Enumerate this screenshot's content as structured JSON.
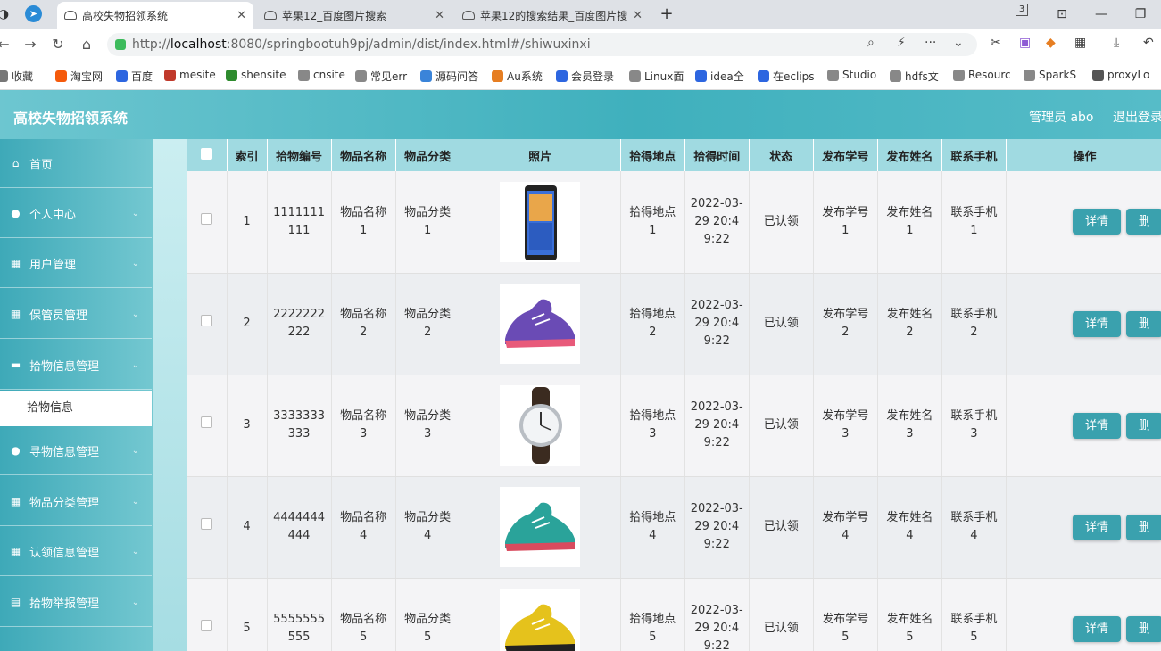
{
  "browser": {
    "tabs": [
      {
        "title": "高校失物招领系统"
      },
      {
        "title": "苹果12_百度图片搜索"
      },
      {
        "title": "苹果12的搜索结果_百度图片搜"
      }
    ],
    "new_tab_label": "+",
    "url_prefix": "http://",
    "url_host": "localhost",
    "url_rest": ":8080/springbootuh9pj/admin/dist/index.html#/shiwuxinxi",
    "bookmarks": [
      {
        "label": "收藏",
        "color": "#777777"
      },
      {
        "label": "淘宝网",
        "color": "#f55a0b"
      },
      {
        "label": "百度",
        "color": "#2d66e0"
      },
      {
        "label": "mesite",
        "color": "#c0392b"
      },
      {
        "label": "shensite",
        "color": "#2e8b2e"
      },
      {
        "label": "cnsite",
        "color": "#888888"
      },
      {
        "label": "常见err",
        "color": "#888888"
      },
      {
        "label": "源码问答",
        "color": "#3a84d9"
      },
      {
        "label": "Au系统",
        "color": "#e67e22"
      },
      {
        "label": "会员登录",
        "color": "#2d66e0"
      },
      {
        "label": "Linux面",
        "color": "#888888"
      },
      {
        "label": "idea全",
        "color": "#2d66e0"
      },
      {
        "label": "在eclips",
        "color": "#2d66e0"
      },
      {
        "label": "Studio",
        "color": "#888888"
      },
      {
        "label": "hdfs文",
        "color": "#888888"
      },
      {
        "label": "Resourc",
        "color": "#888888"
      },
      {
        "label": "SparkS",
        "color": "#888888"
      },
      {
        "label": "proxyLo",
        "color": "#555555"
      }
    ]
  },
  "header": {
    "title": "高校失物招领系统",
    "admin": "管理员 abo",
    "logout": "退出登录"
  },
  "sidebar": {
    "items": [
      {
        "label": "首页",
        "icon": "home-icon",
        "glyph": "⌂"
      },
      {
        "label": "个人中心",
        "icon": "user-icon",
        "glyph": "●"
      },
      {
        "label": "用户管理",
        "icon": "grid-icon",
        "glyph": "▦"
      },
      {
        "label": "保管员管理",
        "icon": "grid-icon",
        "glyph": "▦"
      },
      {
        "label": "拾物信息管理",
        "icon": "monitor-icon",
        "glyph": "▬"
      },
      {
        "label": "寻物信息管理",
        "icon": "user-icon",
        "glyph": "●"
      },
      {
        "label": "物品分类管理",
        "icon": "grid-icon",
        "glyph": "▦"
      },
      {
        "label": "认领信息管理",
        "icon": "grid-icon",
        "glyph": "▦"
      },
      {
        "label": "拾物举报管理",
        "icon": "doc-icon",
        "glyph": "▤"
      }
    ],
    "sub_item": "拾物信息"
  },
  "table": {
    "columns": [
      "索引",
      "拾物编号",
      "物品名称",
      "物品分类",
      "照片",
      "拾得地点",
      "拾得时间",
      "状态",
      "发布学号",
      "发布姓名",
      "联系手机",
      "操作"
    ],
    "detail_label": "详情",
    "delete_label": "删",
    "rows": [
      {
        "index": "1",
        "code": "1111111111",
        "name": "物品名称1",
        "category": "物品分类1",
        "photo": "phone",
        "place": "拾得地点1",
        "time": "2022-03-29 20:49:22",
        "status": "已认领",
        "student_id": "发布学号1",
        "student_name": "发布姓名1",
        "phone": "联系手机1"
      },
      {
        "index": "2",
        "code": "2222222222",
        "name": "物品名称2",
        "category": "物品分类2",
        "photo": "shoe-purple",
        "place": "拾得地点2",
        "time": "2022-03-29 20:49:22",
        "status": "已认领",
        "student_id": "发布学号2",
        "student_name": "发布姓名2",
        "phone": "联系手机2"
      },
      {
        "index": "3",
        "code": "3333333333",
        "name": "物品名称3",
        "category": "物品分类3",
        "photo": "watch",
        "place": "拾得地点3",
        "time": "2022-03-29 20:49:22",
        "status": "已认领",
        "student_id": "发布学号3",
        "student_name": "发布姓名3",
        "phone": "联系手机3"
      },
      {
        "index": "4",
        "code": "4444444444",
        "name": "物品名称4",
        "category": "物品分类4",
        "photo": "shoe-teal",
        "place": "拾得地点4",
        "time": "2022-03-29 20:49:22",
        "status": "已认领",
        "student_id": "发布学号4",
        "student_name": "发布姓名4",
        "phone": "联系手机4"
      },
      {
        "index": "5",
        "code": "5555555555",
        "name": "物品名称5",
        "category": "物品分类5",
        "photo": "shoe-yellow",
        "place": "拾得地点5",
        "time": "2022-03-29 20:49:22",
        "status": "已认领",
        "student_id": "发布学号5",
        "student_name": "发布姓名5",
        "phone": "联系手机5"
      }
    ]
  }
}
